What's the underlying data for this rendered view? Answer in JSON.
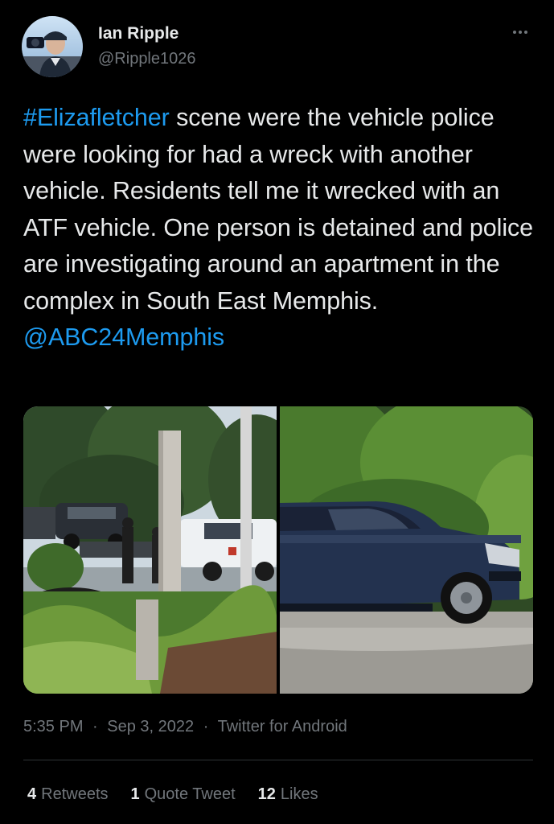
{
  "author": {
    "name": "Ian Ripple",
    "handle": "@Ripple1026"
  },
  "tweet": {
    "hashtag": "#Elizafletcher",
    "text": " scene were the vehicle police were looking for had a wreck with another vehicle. Residents tell me it wrecked with an ATF vehicle. One person is detained and police are investigating around an apartment in the complex in South East Memphis. ",
    "mention": "@ABC24Memphis"
  },
  "media": [
    {
      "alt": "photo-left"
    },
    {
      "alt": "photo-right"
    }
  ],
  "meta": {
    "time": "5:35 PM",
    "date": "Sep 3, 2022",
    "separator": "·",
    "source": "Twitter for Android"
  },
  "stats": {
    "retweets_count": "4",
    "retweets_label": "Retweets",
    "quote_count": "1",
    "quote_label": "Quote Tweet",
    "likes_count": "12",
    "likes_label": "Likes"
  },
  "colors": {
    "background": "#000000",
    "text": "#e7e9ea",
    "secondary": "#71767b",
    "link": "#1d9bf0",
    "divider": "#2f3336"
  },
  "icons": {
    "more": "more-horizontal-icon"
  }
}
